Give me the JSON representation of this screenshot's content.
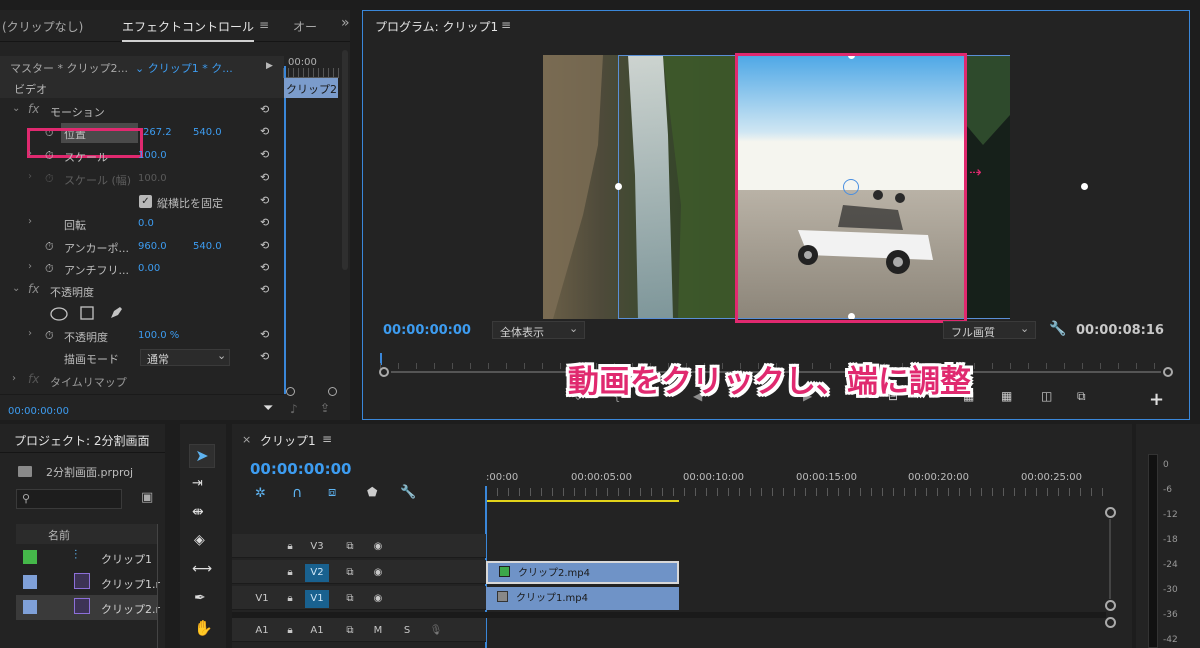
{
  "effect_controls": {
    "tab_left": "(クリップなし)",
    "tab_active": "エフェクトコントロール",
    "tab_menu": "≡",
    "tab_next": "オー",
    "more": "»",
    "source_master": "マスター * クリップ2...",
    "source_clip": "クリップ1 * ク...",
    "timecode_head": "00:00",
    "section_video": "ビデオ",
    "clip_label": "クリップ2",
    "motion": "モーション",
    "position_label": "位置",
    "position_x": "267.2",
    "position_y": "540.0",
    "scale_label": "スケール",
    "scale_value": "100.0",
    "scale_width_label": "スケール (幅)",
    "scale_width_value": "100.0",
    "uniform_scale_label": "縦横比を固定",
    "rotation_label": "回転",
    "rotation_value": "0.0",
    "anchor_label": "アンカーポ...",
    "anchor_x": "960.0",
    "anchor_y": "540.0",
    "antiflicker_label": "アンチフリ...",
    "antiflicker_value": "0.00",
    "opacity_section": "不透明度",
    "opacity_label": "不透明度",
    "opacity_value": "100.0 %",
    "blend_mode_label": "描画モード",
    "blend_mode_value": "通常",
    "time_remap": "タイムリマップ",
    "footer_time": "00:00:00:00"
  },
  "program_monitor": {
    "title": "プログラム: クリップ1",
    "title_menu": "≡",
    "timecode_current": "00:00:00:00",
    "zoom_value": "全体表示",
    "quality_value": "フル画質",
    "timecode_duration": "00:00:08:16",
    "annotation": "動画をクリックし、端に調整",
    "add_button": "+"
  },
  "project": {
    "title": "プロジェクト: 2分割画面",
    "file": "2分割画面.prproj",
    "column_name": "名前",
    "items": [
      {
        "name": "クリップ1",
        "color": "#45b84a"
      },
      {
        "name": "クリップ1.r",
        "color": "#7fa0d8"
      },
      {
        "name": "クリップ2.r",
        "color": "#7fa0d8"
      }
    ]
  },
  "timeline": {
    "close": "×",
    "title": "クリップ1",
    "title_menu": "≡",
    "timecode": "00:00:00:00",
    "ruler": [
      ":00:00",
      "00:00:05:00",
      "00:00:10:00",
      "00:00:15:00",
      "00:00:20:00",
      "00:00:25:00"
    ],
    "tracks": {
      "v3": "V3",
      "v2": "V2",
      "v1_src": "V1",
      "v1": "V1",
      "a1_src": "A1",
      "a1": "A1",
      "m": "M",
      "s": "S"
    },
    "clip_v2": "クリップ2.mp4",
    "clip_v1": "クリップ1.mp4"
  },
  "meter": {
    "ticks": [
      "0",
      "-6",
      "-12",
      "-18",
      "-24",
      "-30",
      "-36",
      "-42"
    ]
  },
  "colors": {
    "accent": "#3d9cf0",
    "highlight": "#e0296f",
    "panel": "#232323"
  }
}
